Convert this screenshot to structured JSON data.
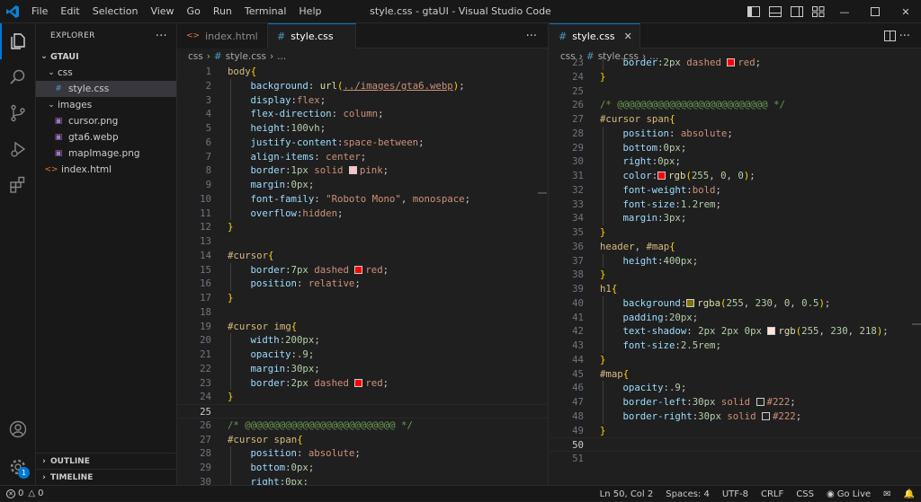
{
  "menu": {
    "file": "File",
    "edit": "Edit",
    "selection": "Selection",
    "view": "View",
    "go": "Go",
    "run": "Run",
    "terminal": "Terminal",
    "help": "Help"
  },
  "window_title": "style.css - gtaUI - Visual Studio Code",
  "sidebar": {
    "header": "EXPLORER",
    "more": "···",
    "root": "GTAUI",
    "tree": [
      {
        "label": "css",
        "type": "folder",
        "depth": 1
      },
      {
        "label": "style.css",
        "type": "css",
        "depth": 2,
        "selected": true
      },
      {
        "label": "images",
        "type": "folder",
        "depth": 1
      },
      {
        "label": "cursor.png",
        "type": "png",
        "depth": 2
      },
      {
        "label": "gta6.webp",
        "type": "png",
        "depth": 2
      },
      {
        "label": "mapImage.png",
        "type": "png",
        "depth": 2
      },
      {
        "label": "index.html",
        "type": "html",
        "depth": 1
      }
    ],
    "outline": "OUTLINE",
    "timeline": "TIMELINE"
  },
  "activity_badge": "1",
  "left_editor": {
    "tabs": [
      {
        "label": "index.html",
        "icon": "<>",
        "active": false
      },
      {
        "label": "style.css",
        "icon": "#",
        "active": true
      }
    ],
    "breadcrumb": [
      "css",
      "›",
      "#",
      "style.css",
      "›",
      "..."
    ],
    "first_line": 1,
    "current_line": 25,
    "lines": [
      [
        [
          "sel",
          "body"
        ],
        [
          "br",
          "{"
        ]
      ],
      [
        [
          "in",
          1
        ],
        [
          "prop",
          "background"
        ],
        [
          "pun",
          ": "
        ],
        [
          "fn",
          "url"
        ],
        [
          "br",
          "("
        ],
        [
          "url",
          "../images/gta6.webp"
        ],
        [
          "br",
          ")"
        ],
        [
          "pun",
          ";"
        ]
      ],
      [
        [
          "in",
          1
        ],
        [
          "prop",
          "display"
        ],
        [
          "pun",
          ":"
        ],
        [
          "str",
          "flex"
        ],
        [
          "pun",
          ";"
        ]
      ],
      [
        [
          "in",
          1
        ],
        [
          "prop",
          "flex-direction"
        ],
        [
          "pun",
          ": "
        ],
        [
          "str",
          "column"
        ],
        [
          "pun",
          ";"
        ]
      ],
      [
        [
          "in",
          1
        ],
        [
          "prop",
          "height"
        ],
        [
          "pun",
          ":"
        ],
        [
          "num",
          "100vh"
        ],
        [
          "pun",
          ";"
        ]
      ],
      [
        [
          "in",
          1
        ],
        [
          "prop",
          "justify-content"
        ],
        [
          "pun",
          ":"
        ],
        [
          "str",
          "space-between"
        ],
        [
          "pun",
          ";"
        ]
      ],
      [
        [
          "in",
          1
        ],
        [
          "prop",
          "align-items"
        ],
        [
          "pun",
          ": "
        ],
        [
          "str",
          "center"
        ],
        [
          "pun",
          ";"
        ]
      ],
      [
        [
          "in",
          1
        ],
        [
          "prop",
          "border"
        ],
        [
          "pun",
          ":"
        ],
        [
          "num",
          "1px"
        ],
        [
          "pun",
          " "
        ],
        [
          "str",
          "solid"
        ],
        [
          "pun",
          " "
        ],
        [
          "sw",
          "#ffc0cb"
        ],
        [
          "str",
          "pink"
        ],
        [
          "pun",
          ";"
        ]
      ],
      [
        [
          "in",
          1
        ],
        [
          "prop",
          "margin"
        ],
        [
          "pun",
          ":"
        ],
        [
          "num",
          "0px"
        ],
        [
          "pun",
          ";"
        ]
      ],
      [
        [
          "in",
          1
        ],
        [
          "prop",
          "font-family"
        ],
        [
          "pun",
          ": "
        ],
        [
          "str",
          "\"Roboto Mono\""
        ],
        [
          "pun",
          ", "
        ],
        [
          "str",
          "monospace"
        ],
        [
          "pun",
          ";"
        ]
      ],
      [
        [
          "in",
          1
        ],
        [
          "prop",
          "overflow"
        ],
        [
          "pun",
          ":"
        ],
        [
          "str",
          "hidden"
        ],
        [
          "pun",
          ";"
        ]
      ],
      [
        [
          "br",
          "}"
        ]
      ],
      [],
      [
        [
          "sel",
          "#cursor"
        ],
        [
          "br",
          "{"
        ]
      ],
      [
        [
          "in",
          1
        ],
        [
          "prop",
          "border"
        ],
        [
          "pun",
          ":"
        ],
        [
          "num",
          "7px"
        ],
        [
          "pun",
          " "
        ],
        [
          "str",
          "dashed"
        ],
        [
          "pun",
          " "
        ],
        [
          "sw",
          "#ff0000"
        ],
        [
          "str",
          "red"
        ],
        [
          "pun",
          ";"
        ]
      ],
      [
        [
          "in",
          1
        ],
        [
          "prop",
          "position"
        ],
        [
          "pun",
          ": "
        ],
        [
          "str",
          "relative"
        ],
        [
          "pun",
          ";"
        ]
      ],
      [
        [
          "br",
          "}"
        ]
      ],
      [],
      [
        [
          "sel",
          "#cursor img"
        ],
        [
          "br",
          "{"
        ]
      ],
      [
        [
          "in",
          1
        ],
        [
          "prop",
          "width"
        ],
        [
          "pun",
          ":"
        ],
        [
          "num",
          "200px"
        ],
        [
          "pun",
          ";"
        ]
      ],
      [
        [
          "in",
          1
        ],
        [
          "prop",
          "opacity"
        ],
        [
          "pun",
          ":"
        ],
        [
          "num",
          ".9"
        ],
        [
          "pun",
          ";"
        ]
      ],
      [
        [
          "in",
          1
        ],
        [
          "prop",
          "margin"
        ],
        [
          "pun",
          ":"
        ],
        [
          "num",
          "30px"
        ],
        [
          "pun",
          ";"
        ]
      ],
      [
        [
          "in",
          1
        ],
        [
          "prop",
          "border"
        ],
        [
          "pun",
          ":"
        ],
        [
          "num",
          "2px"
        ],
        [
          "pun",
          " "
        ],
        [
          "str",
          "dashed"
        ],
        [
          "pun",
          " "
        ],
        [
          "sw",
          "#ff0000"
        ],
        [
          "str",
          "red"
        ],
        [
          "pun",
          ";"
        ]
      ],
      [
        [
          "br",
          "}"
        ]
      ],
      [],
      [
        [
          "com",
          "/* @@@@@@@@@@@@@@@@@@@@@@@@@@ */"
        ]
      ],
      [
        [
          "sel",
          "#cursor span"
        ],
        [
          "br",
          "{"
        ]
      ],
      [
        [
          "in",
          1
        ],
        [
          "prop",
          "position"
        ],
        [
          "pun",
          ": "
        ],
        [
          "str",
          "absolute"
        ],
        [
          "pun",
          ";"
        ]
      ],
      [
        [
          "in",
          1
        ],
        [
          "prop",
          "bottom"
        ],
        [
          "pun",
          ":"
        ],
        [
          "num",
          "0px"
        ],
        [
          "pun",
          ";"
        ]
      ],
      [
        [
          "in",
          1
        ],
        [
          "prop",
          "right"
        ],
        [
          "pun",
          ":"
        ],
        [
          "num",
          "0px"
        ],
        [
          "pun",
          ";"
        ]
      ]
    ]
  },
  "right_editor": {
    "tabs": [
      {
        "label": "style.css",
        "icon": "#",
        "active": true
      }
    ],
    "breadcrumb": [
      "css",
      "›",
      "#",
      "style.css",
      "›",
      "..."
    ],
    "first_line": 23,
    "current_line": 50,
    "lines": [
      [
        [
          "in",
          1
        ],
        [
          "prop",
          "border"
        ],
        [
          "pun",
          ":"
        ],
        [
          "num",
          "2px"
        ],
        [
          "pun",
          " "
        ],
        [
          "str",
          "dashed"
        ],
        [
          "pun",
          " "
        ],
        [
          "sw",
          "#ff0000"
        ],
        [
          "str",
          "red"
        ],
        [
          "pun",
          ";"
        ]
      ],
      [
        [
          "br",
          "}"
        ]
      ],
      [],
      [
        [
          "com",
          "/* @@@@@@@@@@@@@@@@@@@@@@@@@@ */"
        ]
      ],
      [
        [
          "sel",
          "#cursor span"
        ],
        [
          "br",
          "{"
        ]
      ],
      [
        [
          "in",
          1
        ],
        [
          "prop",
          "position"
        ],
        [
          "pun",
          ": "
        ],
        [
          "str",
          "absolute"
        ],
        [
          "pun",
          ";"
        ]
      ],
      [
        [
          "in",
          1
        ],
        [
          "prop",
          "bottom"
        ],
        [
          "pun",
          ":"
        ],
        [
          "num",
          "0px"
        ],
        [
          "pun",
          ";"
        ]
      ],
      [
        [
          "in",
          1
        ],
        [
          "prop",
          "right"
        ],
        [
          "pun",
          ":"
        ],
        [
          "num",
          "0px"
        ],
        [
          "pun",
          ";"
        ]
      ],
      [
        [
          "in",
          1
        ],
        [
          "prop",
          "color"
        ],
        [
          "pun",
          ":"
        ],
        [
          "sw",
          "#ff0000"
        ],
        [
          "fn",
          "rgb"
        ],
        [
          "br",
          "("
        ],
        [
          "num",
          "255"
        ],
        [
          "pun",
          ", "
        ],
        [
          "num",
          "0"
        ],
        [
          "pun",
          ", "
        ],
        [
          "num",
          "0"
        ],
        [
          "br",
          ")"
        ],
        [
          "pun",
          ";"
        ]
      ],
      [
        [
          "in",
          1
        ],
        [
          "prop",
          "font-weight"
        ],
        [
          "pun",
          ":"
        ],
        [
          "str",
          "bold"
        ],
        [
          "pun",
          ";"
        ]
      ],
      [
        [
          "in",
          1
        ],
        [
          "prop",
          "font-size"
        ],
        [
          "pun",
          ":"
        ],
        [
          "num",
          "1.2rem"
        ],
        [
          "pun",
          ";"
        ]
      ],
      [
        [
          "in",
          1
        ],
        [
          "prop",
          "margin"
        ],
        [
          "pun",
          ":"
        ],
        [
          "num",
          "3px"
        ],
        [
          "pun",
          ";"
        ]
      ],
      [
        [
          "br",
          "}"
        ]
      ],
      [
        [
          "sel",
          "header"
        ],
        [
          "pun",
          ", "
        ],
        [
          "sel",
          "#map"
        ],
        [
          "br",
          "{"
        ]
      ],
      [
        [
          "in",
          1
        ],
        [
          "prop",
          "height"
        ],
        [
          "pun",
          ":"
        ],
        [
          "num",
          "400px"
        ],
        [
          "pun",
          ";"
        ]
      ],
      [
        [
          "br",
          "}"
        ]
      ],
      [
        [
          "sel",
          "h1"
        ],
        [
          "br",
          "{"
        ]
      ],
      [
        [
          "in",
          1
        ],
        [
          "prop",
          "background"
        ],
        [
          "pun",
          ":"
        ],
        [
          "sw",
          "#7f7300"
        ],
        [
          "fn",
          "rgba"
        ],
        [
          "br",
          "("
        ],
        [
          "num",
          "255"
        ],
        [
          "pun",
          ", "
        ],
        [
          "num",
          "230"
        ],
        [
          "pun",
          ", "
        ],
        [
          "num",
          "0"
        ],
        [
          "pun",
          ", "
        ],
        [
          "num",
          "0.5"
        ],
        [
          "br",
          ")"
        ],
        [
          "pun",
          ";"
        ]
      ],
      [
        [
          "in",
          1
        ],
        [
          "prop",
          "padding"
        ],
        [
          "pun",
          ":"
        ],
        [
          "num",
          "20px"
        ],
        [
          "pun",
          ";"
        ]
      ],
      [
        [
          "in",
          1
        ],
        [
          "prop",
          "text-shadow"
        ],
        [
          "pun",
          ": "
        ],
        [
          "num",
          "2px"
        ],
        [
          "pun",
          " "
        ],
        [
          "num",
          "2px"
        ],
        [
          "pun",
          " "
        ],
        [
          "num",
          "0px"
        ],
        [
          "pun",
          " "
        ],
        [
          "sw",
          "#ffe6da"
        ],
        [
          "fn",
          "rgb"
        ],
        [
          "br",
          "("
        ],
        [
          "num",
          "255"
        ],
        [
          "pun",
          ", "
        ],
        [
          "num",
          "230"
        ],
        [
          "pun",
          ", "
        ],
        [
          "num",
          "218"
        ],
        [
          "br",
          ")"
        ],
        [
          "pun",
          ";"
        ]
      ],
      [
        [
          "in",
          1
        ],
        [
          "prop",
          "font-size"
        ],
        [
          "pun",
          ":"
        ],
        [
          "num",
          "2.5rem"
        ],
        [
          "pun",
          ";"
        ]
      ],
      [
        [
          "br",
          "}"
        ]
      ],
      [
        [
          "sel",
          "#map"
        ],
        [
          "br",
          "{"
        ]
      ],
      [
        [
          "in",
          1
        ],
        [
          "prop",
          "opacity"
        ],
        [
          "pun",
          ":"
        ],
        [
          "num",
          ".9"
        ],
        [
          "pun",
          ";"
        ]
      ],
      [
        [
          "in",
          1
        ],
        [
          "prop",
          "border-left"
        ],
        [
          "pun",
          ":"
        ],
        [
          "num",
          "30px"
        ],
        [
          "pun",
          " "
        ],
        [
          "str",
          "solid"
        ],
        [
          "pun",
          " "
        ],
        [
          "sw",
          "#222222"
        ],
        [
          "str",
          "#222"
        ],
        [
          "pun",
          ";"
        ]
      ],
      [
        [
          "in",
          1
        ],
        [
          "prop",
          "border-right"
        ],
        [
          "pun",
          ":"
        ],
        [
          "num",
          "30px"
        ],
        [
          "pun",
          " "
        ],
        [
          "str",
          "solid"
        ],
        [
          "pun",
          " "
        ],
        [
          "sw",
          "#222222"
        ],
        [
          "str",
          "#222"
        ],
        [
          "pun",
          ";"
        ]
      ],
      [
        [
          "br",
          "}"
        ]
      ],
      [],
      []
    ]
  },
  "status": {
    "errors": "0",
    "warnings": "0",
    "position": "Ln 50, Col 2",
    "spaces": "Spaces: 4",
    "encoding": "UTF-8",
    "eol": "CRLF",
    "language": "CSS",
    "golive": "Go Live"
  }
}
